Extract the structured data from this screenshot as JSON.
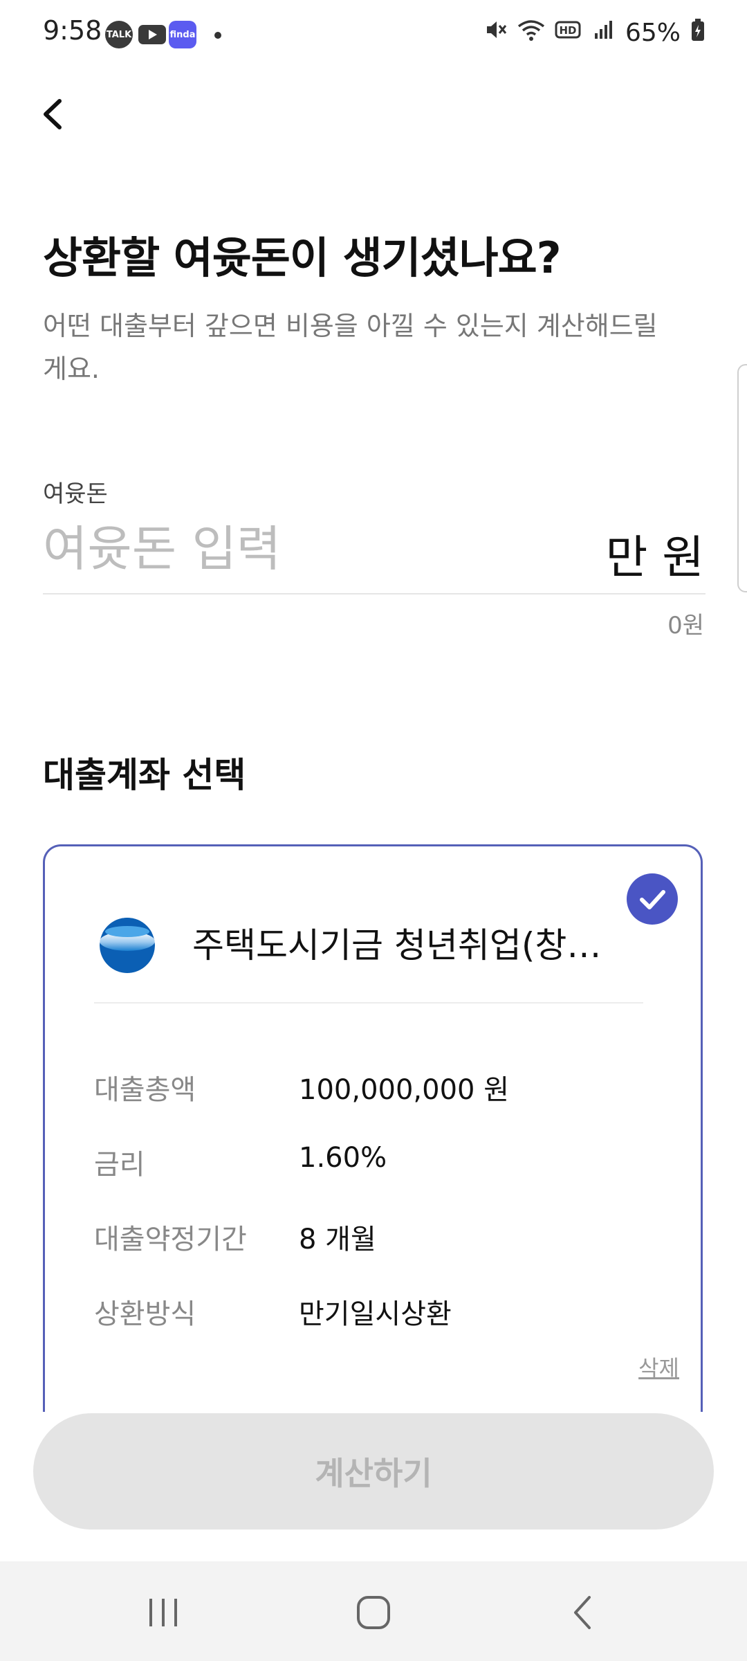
{
  "status_bar": {
    "time": "9:58",
    "apps": [
      {
        "name": "talk-badge",
        "text": "TALK",
        "color": "#3c3c3c"
      },
      {
        "name": "youtube-badge",
        "text": "",
        "color": "#3c3c3c"
      },
      {
        "name": "finda-badge",
        "text": "finda",
        "color": "#5b5bf0"
      }
    ],
    "battery": "65%"
  },
  "header": {
    "headline": "상환할 여윳돈이 생기셨나요?",
    "subtext": "어떤 대출부터 갚으면 비용을 아낄 수 있는지 계산해드릴게요."
  },
  "amount_field": {
    "label": "여윳돈",
    "placeholder": "여윳돈 입력",
    "unit": "만 원",
    "helper": "0원"
  },
  "loan_section": {
    "title": "대출계좌 선택",
    "card": {
      "name": "주택도시기금 청년취업(창…",
      "selected": true,
      "accent_color": "#4a55c4",
      "rows": [
        {
          "label": "대출총액",
          "value": "100,000,000 원"
        },
        {
          "label": "금리",
          "value": "1.60%"
        },
        {
          "label": "대출약정기간",
          "value": "8 개월"
        },
        {
          "label": "상환방식",
          "value": "만기일시상환"
        }
      ],
      "delete_label": "삭제"
    }
  },
  "calc_button_label": "계산하기",
  "nav": {
    "items": [
      "recent-apps",
      "home",
      "back"
    ]
  }
}
